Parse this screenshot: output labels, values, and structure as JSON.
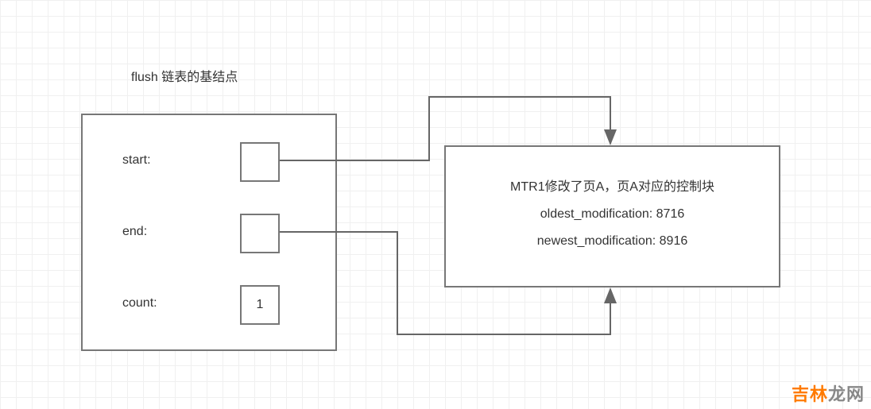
{
  "title": "flush 链表的基结点",
  "basenode": {
    "rows": [
      {
        "label": "start:",
        "value": ""
      },
      {
        "label": "end:",
        "value": ""
      },
      {
        "label": "count:",
        "value": "1"
      }
    ]
  },
  "control_block": {
    "header": "MTR1修改了页A，页A对应的控制块",
    "oldest_label": "oldest_modification:",
    "oldest_value": "8716",
    "newest_label": "newest_modification:",
    "newest_value": "8916"
  },
  "watermark": {
    "part1": "吉林",
    "part2": "龙网"
  }
}
